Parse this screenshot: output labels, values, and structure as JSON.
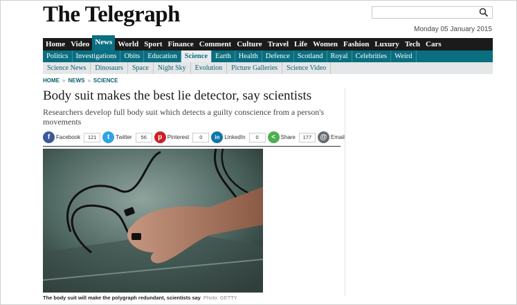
{
  "site": {
    "logo": "The Telegraph",
    "date": "Monday 05 January 2015"
  },
  "search": {
    "placeholder": ""
  },
  "nav_primary": [
    "Home",
    "Video",
    "News",
    "World",
    "Sport",
    "Finance",
    "Comment",
    "Culture",
    "Travel",
    "Life",
    "Women",
    "Fashion",
    "Luxury",
    "Tech",
    "Cars"
  ],
  "nav_primary_active": "News",
  "nav_secondary": [
    "Politics",
    "Investigations",
    "Obits",
    "Education",
    "Science",
    "Earth",
    "Health",
    "Defence",
    "Scotland",
    "Royal",
    "Celebrities",
    "Weird"
  ],
  "nav_secondary_active": "Science",
  "nav_tertiary": [
    "Science News",
    "Dinosaurs",
    "Space",
    "Night Sky",
    "Evolution",
    "Picture Galleries",
    "Science Video"
  ],
  "breadcrumb": {
    "home": "HOME",
    "news": "NEWS",
    "science": "SCIENCE",
    "sep": "»"
  },
  "article": {
    "headline": "Body suit makes the best lie detector, say scientists",
    "standfirst": "Researchers develop full body suit which detects a guilty conscience from a person's movements",
    "caption": "The body suit will make the polygraph redundant, scientists say",
    "credit": "Photo: GETTY"
  },
  "share": {
    "facebook": {
      "label": "Facebook",
      "count": "121",
      "color": "#3b5998",
      "icon": "f"
    },
    "twitter": {
      "label": "Twitter",
      "count": "56",
      "color": "#2fa3e6",
      "icon": "t"
    },
    "pinterest": {
      "label": "Pinterest",
      "count": "0",
      "color": "#cb2027",
      "icon": "p"
    },
    "linkedin": {
      "label": "LinkedIn",
      "count": "0",
      "color": "#0e76a8",
      "icon": "in"
    },
    "share": {
      "label": "Share",
      "count": "177",
      "color": "#4caf50",
      "icon": "<"
    },
    "email": {
      "label": "Email",
      "color": "#666d72",
      "icon": "@"
    }
  },
  "colors": {
    "teal": "#0a6f80",
    "black_bar": "#1b1b1b",
    "grey_bar": "#e4e6e8"
  }
}
